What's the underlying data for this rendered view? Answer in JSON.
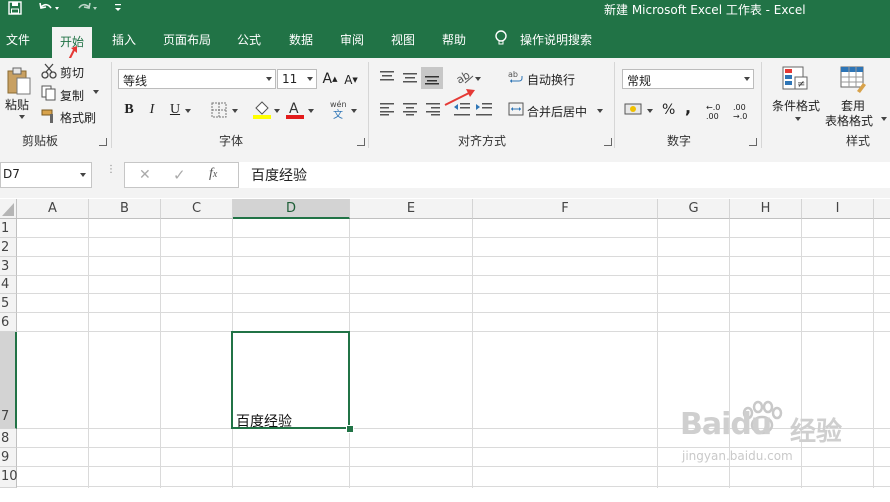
{
  "window": {
    "title": "新建 Microsoft Excel 工作表  -  Excel"
  },
  "tabs": [
    {
      "label": "文件"
    },
    {
      "label": "开始",
      "active": true
    },
    {
      "label": "插入"
    },
    {
      "label": "页面布局"
    },
    {
      "label": "公式"
    },
    {
      "label": "数据"
    },
    {
      "label": "审阅"
    },
    {
      "label": "视图"
    },
    {
      "label": "帮助"
    },
    {
      "label": "操作说明搜索"
    }
  ],
  "clipboard": {
    "paste": "粘贴",
    "cut": "剪切",
    "copy": "复制",
    "format_painter": "格式刷",
    "group": "剪贴板"
  },
  "font": {
    "name": "等线",
    "size": "11",
    "group": "字体"
  },
  "alignment": {
    "wrap": "自动换行",
    "merge": "合并后居中",
    "group": "对齐方式"
  },
  "number": {
    "format": "常规",
    "group": "数字",
    "percent": "%",
    "comma": ",",
    "inc": "←.0 .00",
    "dec": ".00 →.0"
  },
  "styles": {
    "conditional": "条件格式",
    "table_line1": "套用",
    "table_line2": "表格格式",
    "group": "样式"
  },
  "formula_bar": {
    "name_box": "D7",
    "content": "百度经验"
  },
  "columns": [
    "A",
    "B",
    "C",
    "D",
    "E",
    "F",
    "G",
    "H",
    "I"
  ],
  "rows": [
    "1",
    "2",
    "3",
    "4",
    "5",
    "6",
    "7",
    "8",
    "9",
    "10"
  ],
  "cells": {
    "D7": "百度经验"
  },
  "watermark": {
    "brand": "Baidu",
    "suffix": "经验",
    "url": "jingyan.baidu.com"
  },
  "colors": {
    "accent": "#217346",
    "annotation": "#e53935"
  }
}
